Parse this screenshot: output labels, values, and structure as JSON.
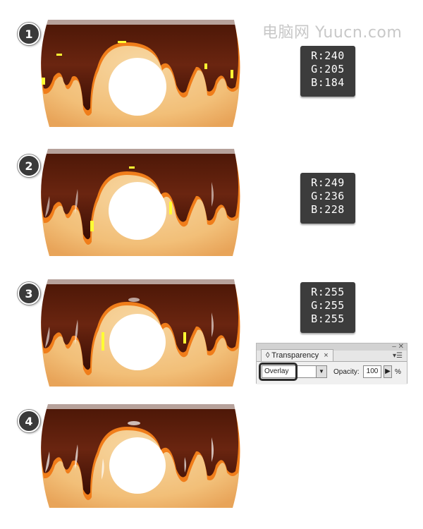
{
  "watermark": "电脑网 Yuucn.com",
  "steps": [
    {
      "number": "1"
    },
    {
      "number": "2"
    },
    {
      "number": "3"
    },
    {
      "number": "4"
    }
  ],
  "swatches": [
    {
      "r": "R:240",
      "g": "G:205",
      "b": "B:184"
    },
    {
      "r": "R:249",
      "g": "G:236",
      "b": "B:228"
    },
    {
      "r": "R:255",
      "g": "G:255",
      "b": "B:255"
    }
  ],
  "transparency_panel": {
    "tab_label": "Transparency",
    "close_glyph": "×",
    "blend_mode": "Overlay",
    "opacity_label": "Opacity:",
    "opacity_value": "100",
    "percent": "%"
  },
  "colors": {
    "dough": "#f2c27c",
    "dough_shadow": "#e29a4c",
    "chocolate": "#5a1e0e",
    "chocolate_dark": "#3b0f05",
    "orange_rim": "#f07d1a",
    "highlight": "#ffffff",
    "guide_yellow": "#ffff33"
  }
}
